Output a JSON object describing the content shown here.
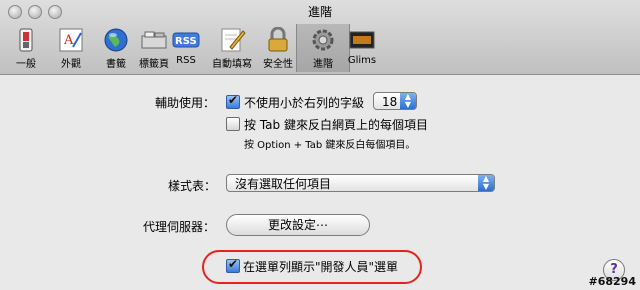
{
  "window": {
    "title": "進階"
  },
  "toolbar": {
    "items": [
      {
        "label": "一般",
        "icon": "switch-icon"
      },
      {
        "label": "外觀",
        "icon": "font-icon"
      },
      {
        "label": "書籤",
        "icon": "globe-icon"
      },
      {
        "label": "標籤頁",
        "icon": "tabs-icon"
      },
      {
        "label": "RSS",
        "icon": "rss-icon"
      },
      {
        "label": "自動填寫",
        "icon": "pencil-icon"
      },
      {
        "label": "安全性",
        "icon": "lock-icon"
      },
      {
        "label": "進階",
        "icon": "gear-icon",
        "selected": true
      },
      {
        "label": "Glims",
        "icon": "glims-icon"
      }
    ]
  },
  "accessibility": {
    "label": "輔助使用：",
    "min_font_checkbox_label": "不使用小於右列的字級",
    "min_font_checked": true,
    "min_font_value": "18",
    "tab_checkbox_label": "按 Tab 鍵來反白網頁上的每個項目",
    "tab_checked": false,
    "tab_hint": "按 Option + Tab 鍵來反白每個項目。"
  },
  "stylesheet": {
    "label": "樣式表：",
    "selected": "沒有選取任何項目"
  },
  "proxy": {
    "label": "代理伺服器：",
    "button_label": "更改設定⋯"
  },
  "develop_menu": {
    "checkbox_label": "在選單列顯示\"開發人員\"選單",
    "checked": true
  },
  "help": {
    "label": "?"
  },
  "watermark": "#68294",
  "colors": {
    "highlight": "#e0251c",
    "accent": "#3c7ad8"
  }
}
